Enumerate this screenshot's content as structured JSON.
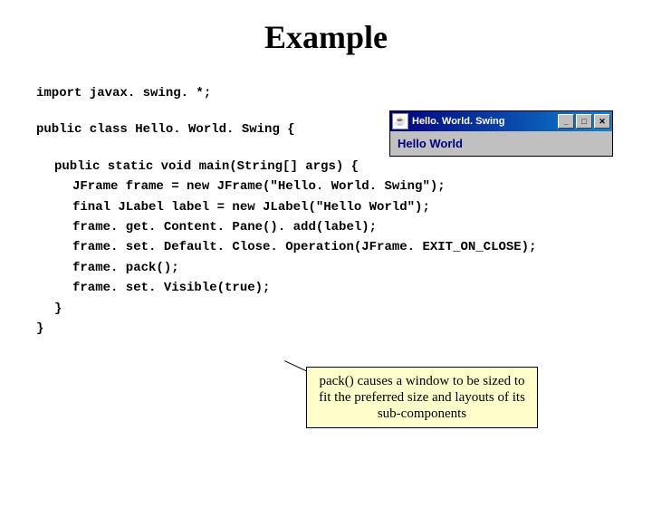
{
  "title": "Example",
  "code": {
    "l1": "import javax. swing. *;",
    "l2": "public class Hello. World. Swing {",
    "l3": "public static void main(String[] args) {",
    "l4": "JFrame frame = new JFrame(\"Hello. World. Swing\");",
    "l5": "final JLabel label = new JLabel(\"Hello World\");",
    "l6": "frame. get. Content. Pane(). add(label);",
    "l7": "frame. set. Default. Close. Operation(JFrame. EXIT_ON_CLOSE);",
    "l8": "frame. pack();",
    "l9": "frame. set. Visible(true);",
    "l10": "}",
    "l11": "}"
  },
  "window": {
    "app_icon": "☕",
    "title": "Hello. World. Swing",
    "min": "_",
    "max": "□",
    "close": "✕",
    "body": "Hello World"
  },
  "note": {
    "text": "pack() causes a window to be sized to fit the preferred size and layouts of its sub-components"
  }
}
